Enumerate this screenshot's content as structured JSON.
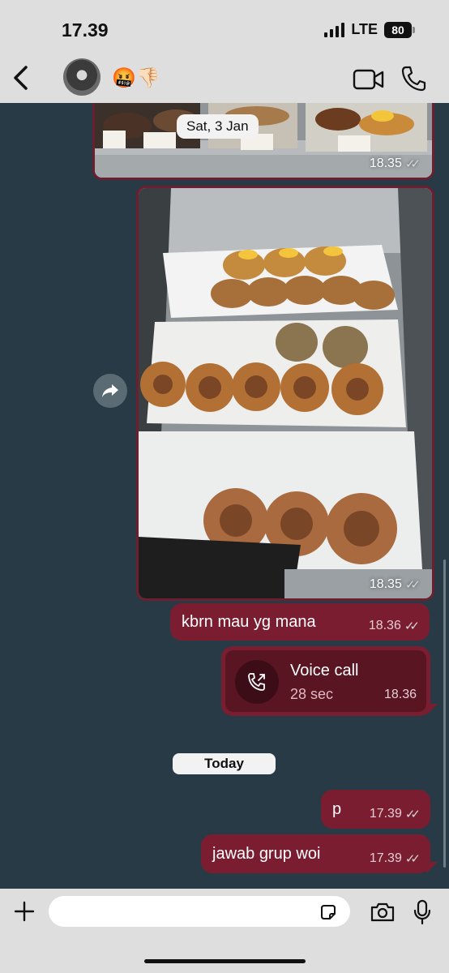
{
  "status_bar": {
    "time": "17.39",
    "network": "LTE",
    "battery": "80"
  },
  "header": {
    "contact_name": "🤬👎🏻"
  },
  "colors": {
    "header_bg": "#dedede",
    "chat_bg": "#283a45",
    "outgoing_bubble": "#7b1d30"
  },
  "chat": {
    "date_separator": "Sat, 3 Jan",
    "today_separator": "Today",
    "image_message_1": {
      "time": "18.35"
    },
    "image_message_2": {
      "time": "18.35"
    },
    "message_kbrn": {
      "text": "kbrn mau yg mana",
      "time": "18.36"
    },
    "voice_call": {
      "title": "Voice call",
      "duration": "28 sec",
      "time": "18.36"
    },
    "message_p": {
      "text": "p",
      "time": "17.39"
    },
    "message_jawab": {
      "text": "jawab grup woi",
      "time": "17.39"
    }
  },
  "input": {
    "placeholder": ""
  }
}
